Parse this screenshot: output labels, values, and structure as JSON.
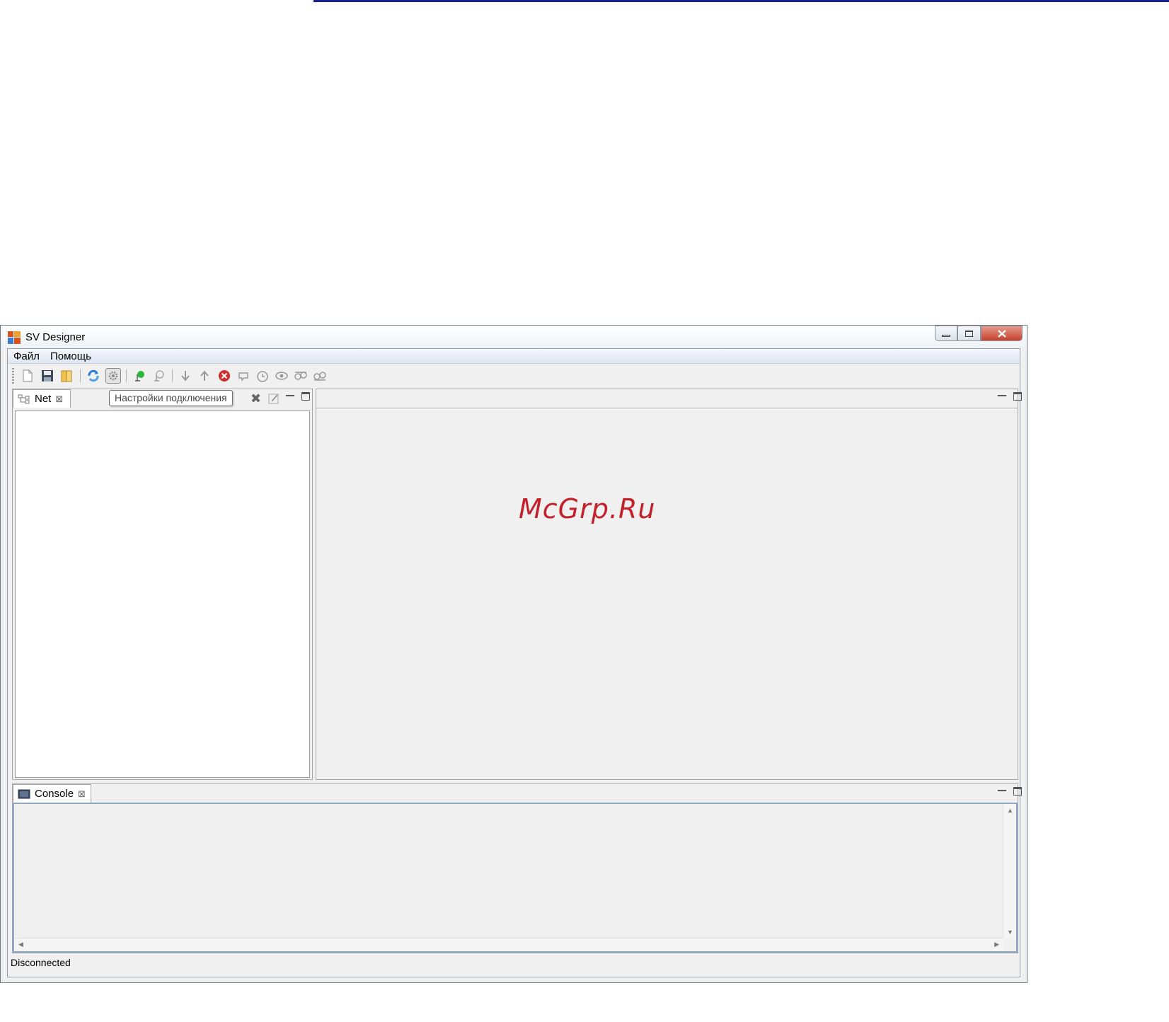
{
  "window": {
    "title": "SV Designer"
  },
  "menu": {
    "items": [
      "Файл",
      "Помощь"
    ]
  },
  "toolbar": {
    "icons": [
      "new-file-icon",
      "save-icon",
      "open-book-icon",
      "refresh-icon",
      "connection-settings-icon",
      "connect-icon",
      "disconnect-icon",
      "download-icon",
      "upload-icon",
      "stop-icon",
      "reset-icon",
      "clock-icon",
      "watch-icon",
      "transfer-icon",
      "transfer-alt-icon"
    ],
    "tooltip": "Настройки подключения"
  },
  "net_panel": {
    "tab_label": "Net"
  },
  "console_panel": {
    "tab_label": "Console"
  },
  "editor": {
    "watermark": "McGrp.Ru"
  },
  "status": {
    "text": "Disconnected"
  },
  "colors": {
    "title_close": "#c4412b",
    "menubar": "#dfe6f1",
    "topline": "#1b1f8a",
    "watermark": "#c4202a"
  }
}
